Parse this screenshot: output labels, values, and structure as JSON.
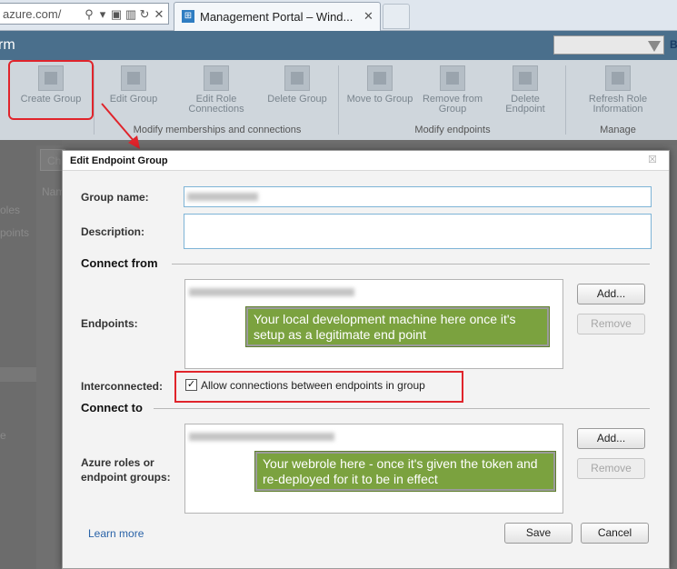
{
  "browser": {
    "address_url": "azure.com/",
    "tab_title": "Management Portal – Wind...",
    "tab_close": "✕",
    "favicon": "windows-logo-icon"
  },
  "portal": {
    "header_fragment": "rm",
    "header_letter": "B"
  },
  "ribbon": {
    "buttons": [
      {
        "label": "Create Group"
      },
      {
        "label": "Edit Group"
      },
      {
        "label": "Edit Role Connections"
      },
      {
        "label": "Delete Group"
      },
      {
        "label": "Move to Group"
      },
      {
        "label": "Remove from Group"
      },
      {
        "label": "Delete Endpoint"
      },
      {
        "label": "Refresh Role Information"
      }
    ],
    "groups": {
      "memberships": "Modify memberships and connections",
      "endpoints": "Modify endpoints",
      "manage": "Manage"
    }
  },
  "background": {
    "filter_fragment": "Ch",
    "column_fragment": "Nam",
    "nav_roles_fragment": "oles",
    "nav_endpoints_fragment": "points",
    "nav_e_fragment": "e"
  },
  "dialog": {
    "title": "Edit Endpoint Group",
    "close_glyph": "☒",
    "group_name_label": "Group name:",
    "description_label": "Description:",
    "connect_from_heading": "Connect from",
    "endpoints_label": "Endpoints:",
    "interconnected_label": "Interconnected:",
    "allow_connections_label": "Allow connections between endpoints in group",
    "connect_to_heading": "Connect to",
    "azure_roles_label": "Azure roles or endpoint groups:",
    "add_label": "Add...",
    "remove_label": "Remove",
    "learn_more": "Learn more",
    "save_label": "Save",
    "cancel_label": "Cancel",
    "checkbox_checked": "✓"
  },
  "callouts": {
    "endpoints": "Your local development machine here once it's setup as a legitimate end point",
    "webrole": "Your webrole here - once it's given the token and re-deployed for it to be in effect"
  },
  "colors": {
    "highlight": "#e0242b",
    "callout_green": "#7ba23f",
    "header_blue": "#4a6f8c"
  }
}
